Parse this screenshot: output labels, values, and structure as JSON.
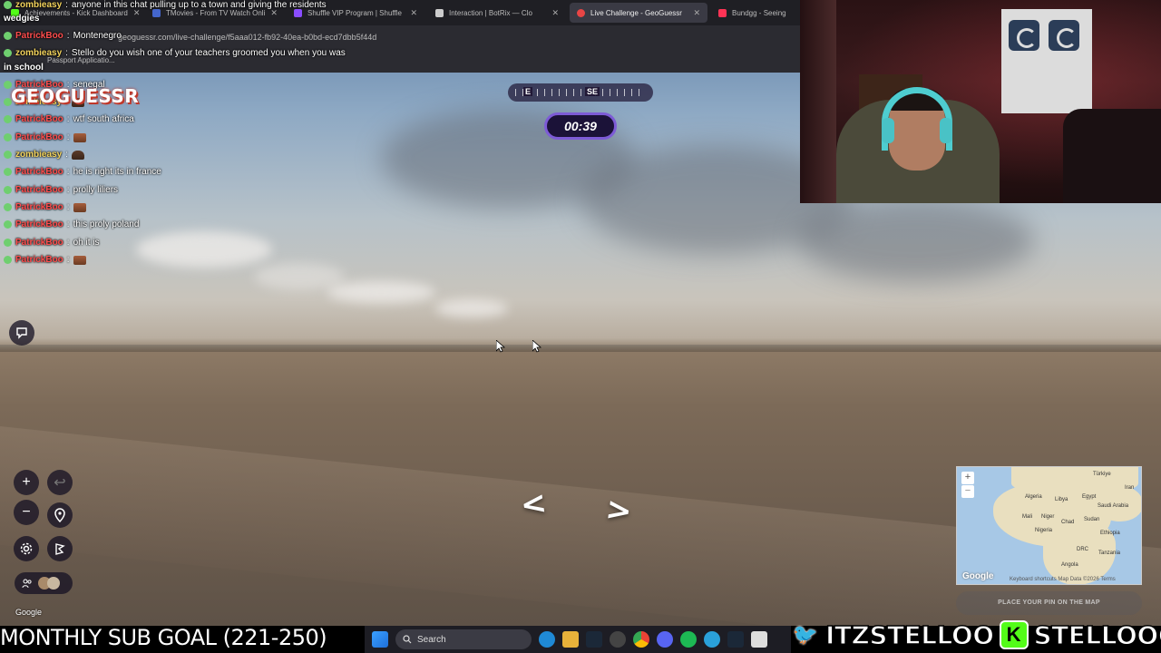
{
  "browser": {
    "tabs": [
      {
        "label": "Achievements - Kick Dashboard",
        "color": "#53fc18"
      },
      {
        "label": "TMovies - From TV Watch Onli",
        "color": "#4466cc"
      },
      {
        "label": "Shuffle VIP Program | Shuffle",
        "color": "#8a4dff"
      },
      {
        "label": "Interaction | BotRix — Clo",
        "color": "#cccccc"
      },
      {
        "label": "Live Challenge - GeoGuessr",
        "color": "#e84545",
        "active": true
      },
      {
        "label": "Bundgg - Seeing",
        "color": "#ff3355"
      }
    ],
    "url": "geoguessr.com/live-challenge/f5aaa012-fb92-40ea-b0bd-ecd7dbb5f44d",
    "bookmark": "Passport Applicatio..."
  },
  "chat": {
    "messages": [
      {
        "user": "zombieasy",
        "text": "anyone in this chat pulling up to a town and giving the residents",
        "type": "zb"
      },
      {
        "user": "",
        "text": "wedgies",
        "type": "cont"
      },
      {
        "user": "PatrickBoo",
        "text": "Montenegro",
        "type": "pb"
      },
      {
        "user": "zombieasy",
        "text": "Stello do you wish one of your teachers groomed you when you was",
        "type": "zb"
      },
      {
        "user": "",
        "text": "in school",
        "type": "cont"
      },
      {
        "user": "PatrickBoo",
        "text": "senegal",
        "type": "pb"
      },
      {
        "user": "zombieasy",
        "text": "",
        "type": "zb",
        "emote": "hat"
      },
      {
        "user": "PatrickBoo",
        "text": "wtf south africa",
        "type": "pb"
      },
      {
        "user": "PatrickBoo",
        "text": "",
        "type": "pb",
        "emote": "box"
      },
      {
        "user": "zombieasy",
        "text": "",
        "type": "zb",
        "emote": "hat"
      },
      {
        "user": "PatrickBoo",
        "text": "he is right its in france",
        "type": "pb"
      },
      {
        "user": "PatrickBoo",
        "text": "prolly liliers",
        "type": "pb"
      },
      {
        "user": "PatrickBoo",
        "text": "",
        "type": "pb",
        "emote": "box"
      },
      {
        "user": "PatrickBoo",
        "text": "this proly poland",
        "type": "pb"
      },
      {
        "user": "PatrickBoo",
        "text": "oh it is",
        "type": "pb"
      },
      {
        "user": "PatrickBoo",
        "text": "",
        "type": "pb",
        "emote": "box"
      }
    ]
  },
  "game": {
    "logo": "GEOGUESSR",
    "compass_e": "E",
    "compass_se": "SE",
    "timer": "00:39",
    "google": "Google",
    "zoom_in": "+",
    "zoom_out": "−",
    "undo": "↩",
    "map_labels": [
      "Türkiye",
      "Iran",
      "Algeria",
      "Libya",
      "Egypt",
      "Saudi Arabia",
      "Mali",
      "Niger",
      "Chad",
      "Sudan",
      "Nigeria",
      "Ethiopia",
      "DRC",
      "Tanzania",
      "Angola"
    ],
    "map_google": "Google",
    "map_footer": "Keyboard shortcuts   Map Data ©2026   Terms",
    "place_pin": "PLACE YOUR PIN ON THE MAP"
  },
  "overlay": {
    "sub_goal": "MONTHLY SUB GOAL (221-250)",
    "twitter": "ITZSTELLOO",
    "kick": "STELLOOO",
    "taskbar_search": "Search"
  }
}
